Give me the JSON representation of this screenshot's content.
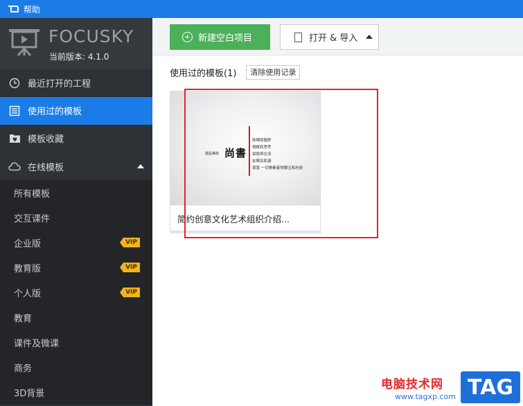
{
  "menubar": {
    "help_label": "帮助"
  },
  "brand": {
    "logo_text": "FOCUSKY",
    "version": "当前版本: 4.1.0"
  },
  "sidebar": {
    "items": [
      {
        "label": "最近打开的工程",
        "icon": "clock-icon"
      },
      {
        "label": "使用过的模板",
        "icon": "list-icon",
        "active": true
      },
      {
        "label": "模板收藏",
        "icon": "heart-folder-icon"
      },
      {
        "label": "在线模板",
        "icon": "cloud-icon"
      }
    ],
    "sub_items": [
      {
        "label": "所有模板"
      },
      {
        "label": "交互课件"
      },
      {
        "label": "企业版",
        "badge": "VIP"
      },
      {
        "label": "教育版",
        "badge": "VIP"
      },
      {
        "label": "个人版",
        "badge": "VIP"
      },
      {
        "label": "教育"
      },
      {
        "label": "课件及微课"
      },
      {
        "label": "商务"
      },
      {
        "label": "3D背景"
      }
    ]
  },
  "toolbar": {
    "new_label": "新建空白项目",
    "open_label": "打开 & 导入"
  },
  "section": {
    "title": "使用过的模板(1)",
    "clear_label": "清除使用记录"
  },
  "template_card": {
    "caption": "简约创意文化艺术组织介绍...",
    "thumb": {
      "small_text": "建設美館",
      "big_text": "尚書",
      "lines": [
        "該標吳圖舒",
        "視概和思考",
        "探索與交流",
        "友陳及和滿",
        "尊尊 一切美都者得關注和內容"
      ]
    }
  },
  "watermark": {
    "site_cn": "电脑技术网",
    "site_url": "www.tagxp.com",
    "tag": "TAG"
  },
  "colors": {
    "accent": "#1b7ce8",
    "sidebar_bg": "#2e3136",
    "new_button": "#4cb05a",
    "vip": "#f2b41e",
    "highlight": "#e12525"
  }
}
